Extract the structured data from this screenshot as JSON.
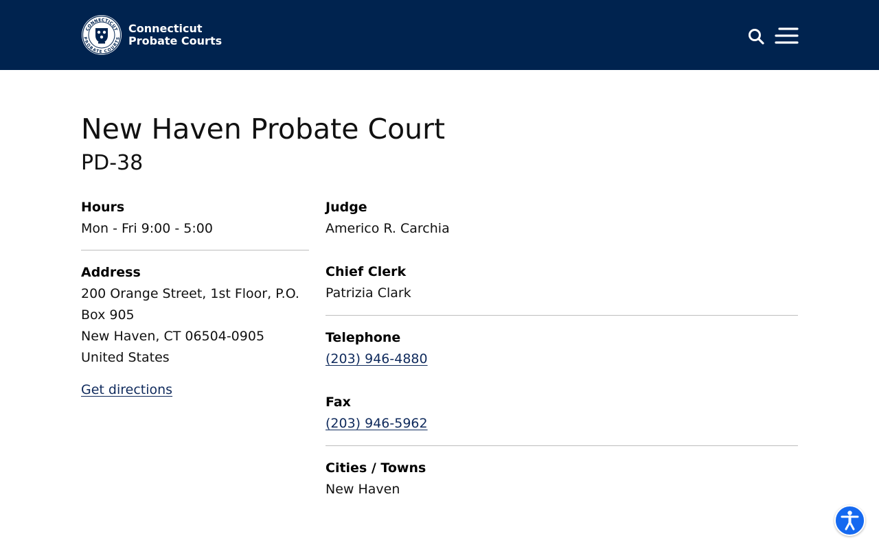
{
  "header": {
    "logo_line1": "Connecticut",
    "logo_line2": "Probate Courts",
    "seal_text_top": "CONNECTICUT",
    "seal_text_bottom": "PROBATE COURTS",
    "search_icon": "search-icon",
    "menu_icon": "hamburger-menu-icon"
  },
  "page": {
    "title": "New Haven Probate Court",
    "subtitle": "PD-38"
  },
  "hours": {
    "label": "Hours",
    "value": "Mon - Fri 9:00 - 5:00"
  },
  "address": {
    "label": "Address",
    "line1": "200 Orange Street, 1st Floor, P.O. Box 905",
    "line2": "New Haven, CT 06504-0905",
    "line3": "United States",
    "directions_label": "Get directions"
  },
  "judge": {
    "label": "Judge",
    "value": "Americo R. Carchia"
  },
  "chief_clerk": {
    "label": "Chief Clerk",
    "value": "Patrizia Clark"
  },
  "telephone": {
    "label": "Telephone",
    "value": "(203) 946-4880"
  },
  "fax": {
    "label": "Fax",
    "value": "(203) 946-5962"
  },
  "cities": {
    "label": "Cities / Towns",
    "value": "New Haven"
  },
  "colors": {
    "header_bg": "#00234f",
    "link": "#0f2a5c",
    "accessibility_button": "#1569f0"
  },
  "accessibility": {
    "icon": "accessibility-person-icon"
  }
}
